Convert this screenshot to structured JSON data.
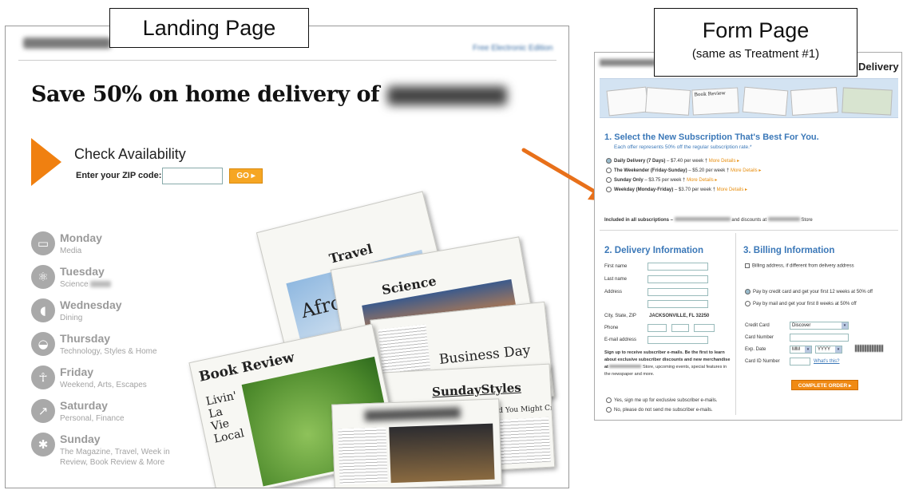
{
  "landing": {
    "label": "Landing Page",
    "headline": "Save 50% on home delivery of",
    "check_title": "Check Availability",
    "zip_label": "Enter your ZIP code:",
    "go_label": "GO ▸",
    "days": [
      {
        "name": "Monday",
        "sub": "Media",
        "icon": "monitor-icon"
      },
      {
        "name": "Tuesday",
        "sub": "Science",
        "icon": "atom-icon"
      },
      {
        "name": "Wednesday",
        "sub": "Dining",
        "icon": "spoon-icon"
      },
      {
        "name": "Thursday",
        "sub": "Technology, Styles & Home",
        "icon": "bowl-icon"
      },
      {
        "name": "Friday",
        "sub": "Weekend, Arts, Escapes",
        "icon": "dancer-icon"
      },
      {
        "name": "Saturday",
        "sub": "Personal, Finance",
        "icon": "trend-icon"
      },
      {
        "name": "Sunday",
        "sub": "The Magazine, Travel, Week in Review, Book Review & More",
        "icon": "palm-icon"
      }
    ],
    "papers": {
      "travel": "Travel",
      "travel_body": "Afro",
      "science": "Science",
      "book_review": "Book Review",
      "book_body": "Livin' La Vie Local",
      "business": "Business Day",
      "sunday_styles": "SundayStyles",
      "sunday_sub": "...a Diamond Under Stress, and You Might Crack"
    }
  },
  "form": {
    "label": "Form Page",
    "label_sub": "(same as Treatment #1)",
    "delivery_word": "Delivery",
    "section1_title": "1. Select the New Subscription That's Best For You.",
    "section1_sub": "Each offer represents 50% off the regular subscription rate.*",
    "options": [
      {
        "label": "Daily Delivery (7 Days)",
        "price": "– $7.40 per week †",
        "more": "More Details ▸",
        "selected": true
      },
      {
        "label": "The Weekender (Friday-Sunday)",
        "price": "– $5.20 per week †",
        "more": "More Details ▸",
        "selected": false
      },
      {
        "label": "Sunday Only",
        "price": "– $3.75 per week †",
        "more": "More Details ▸",
        "selected": false
      },
      {
        "label": "Weekday (Monday-Friday)",
        "price": "– $3.70 per week †",
        "more": "More Details ▸",
        "selected": false
      }
    ],
    "included": "Included in all subscriptions –",
    "included_mid": "and discounts at",
    "included_end": "Store",
    "section2_title": "2. Delivery Information",
    "fields": [
      "First name",
      "Last name",
      "Address",
      "City, State, ZIP",
      "Phone",
      "E-mail address"
    ],
    "city_value": "JACKSONVILLE, FL 32250",
    "signup_text": "Sign up to receive subscriber e-mails. Be the first to learn about exclusive subscriber discounts and new merchandise at",
    "signup_text2": "Store, upcoming events, special features in the newspaper and more.",
    "email_yes": "Yes, sign me up for exclusive subscriber e-mails.",
    "email_no": "No, please do not send me subscriber e-mails.",
    "section3_title": "3. Billing Information",
    "billing_diff": "Billing address, if different from delivery address",
    "pay_card": "Pay by credit card and get your first 12 weeks at 50% off",
    "pay_mail": "Pay by mail and get your first 8 weeks at 50% off",
    "card_label": "Credit Card",
    "card_value": "Discover",
    "card_number_label": "Card Number",
    "exp_label": "Exp. Date",
    "exp_mm": "MM",
    "exp_yyyy": "YYYY",
    "cid_label": "Card ID Number",
    "whats_this": "What's this?",
    "complete_label": "COMPLETE ORDER ▸"
  },
  "colors": {
    "accent_orange": "#f08010",
    "form_blue": "#3b78b8",
    "arrow": "#e8701a"
  }
}
